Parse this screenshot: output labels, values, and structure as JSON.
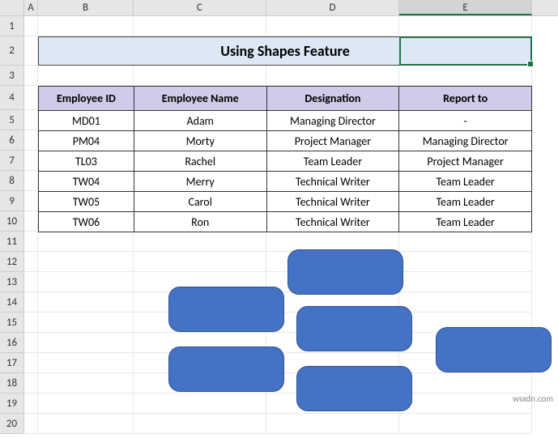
{
  "columns": [
    "A",
    "B",
    "C",
    "D",
    "E"
  ],
  "rows": [
    "1",
    "2",
    "3",
    "4",
    "5",
    "6",
    "7",
    "8",
    "9",
    "10",
    "11",
    "12",
    "13",
    "14",
    "15",
    "16",
    "17",
    "18",
    "19",
    "20"
  ],
  "title": "Using Shapes Feature",
  "headers": {
    "employee_id": "Employee ID",
    "employee_name": "Employee Name",
    "designation": "Designation",
    "report_to": "Report to"
  },
  "data": [
    {
      "id": "MD01",
      "name": "Adam",
      "designation": "Managing Director",
      "report_to": "-"
    },
    {
      "id": "PM04",
      "name": "Morty",
      "designation": "Project Manager",
      "report_to": "Managing Director"
    },
    {
      "id": "TL03",
      "name": "Rachel",
      "designation": "Team Leader",
      "report_to": "Project Manager"
    },
    {
      "id": "TW04",
      "name": "Merry",
      "designation": "Technical Writer",
      "report_to": "Team Leader"
    },
    {
      "id": "TW05",
      "name": "Carol",
      "designation": "Technical Writer",
      "report_to": "Team Leader"
    },
    {
      "id": "TW06",
      "name": "Ron",
      "designation": "Technical Writer",
      "report_to": "Team Leader"
    }
  ],
  "selected_column": "E",
  "watermark": "wsxdn.com",
  "shape_color": "#4472c4"
}
